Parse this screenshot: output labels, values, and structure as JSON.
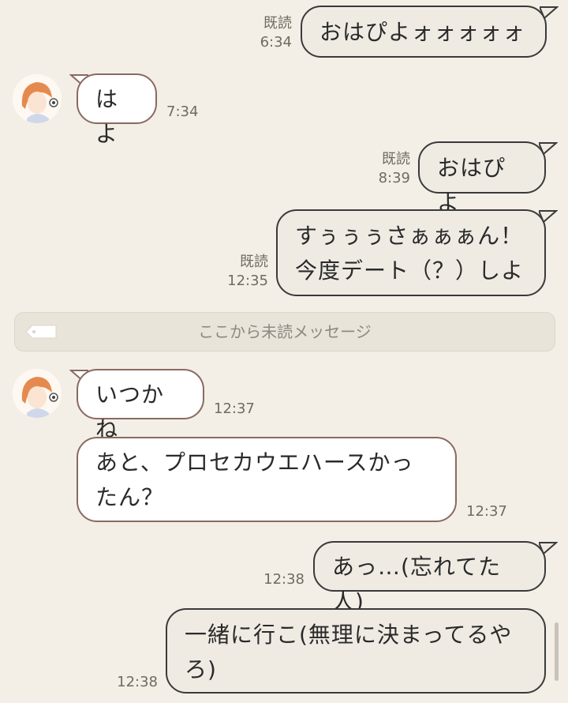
{
  "messages": [
    {
      "dir": "out",
      "text": "おはぴよォォォォォ",
      "read": "既読",
      "time": "6:34"
    },
    {
      "dir": "in",
      "text": "はよ",
      "time": "7:34"
    },
    {
      "dir": "out",
      "text": "おはぴよ",
      "read": "既読",
      "time": "8:39"
    },
    {
      "dir": "out",
      "text": "すぅぅぅさぁぁぁん！\n今度デート（？）しよ",
      "read": "既読",
      "time": "12:35"
    },
    {
      "dir": "in",
      "text": "いつかね",
      "time": "12:37"
    },
    {
      "dir": "in",
      "text": "あと、プロセカウエハースかっ\nたん？",
      "time": "12:37"
    },
    {
      "dir": "out",
      "text": "あっ…(忘れてた人)",
      "time": "12:38"
    },
    {
      "dir": "out",
      "text": "一緒に行こ(無理に決まってるや\nろ)",
      "time": "12:38"
    }
  ],
  "divider": {
    "label": "ここから未読メッセージ"
  },
  "colors": {
    "background": "#f3efe6",
    "outgoing_bubble": "#efebe3",
    "incoming_bubble": "#ffffff",
    "border": "#3a3a3a"
  },
  "icons": {
    "avatar": "contact-avatar",
    "divider_tag": "unread-tag-icon"
  }
}
